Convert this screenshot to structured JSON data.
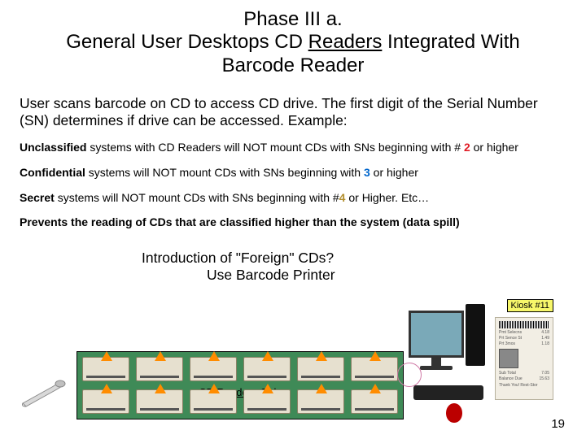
{
  "title": {
    "line1": "Phase III a.",
    "line2_pre": "General User Desktops CD ",
    "line2_under": "Readers",
    "line2_post": " Integrated With",
    "line3": "Barcode Reader"
  },
  "body_intro": "User scans barcode on CD to access CD drive.  The first digit of the Serial Number (SN) determines if drive can be accessed.  Example:",
  "rules": {
    "r1_pre": "Unclassified",
    "r1_mid": " systems with CD Readers will NOT mount CDs with SNs beginning with # ",
    "r1_num": "2",
    "r1_post": " or higher",
    "r2_pre": "Confidential",
    "r2_mid": " systems will NOT mount CDs with SNs beginning with ",
    "r2_num": "3",
    "r2_post": " or higher",
    "r3_pre": "Secret",
    "r3_mid": " systems will NOT mount CDs with SNs beginning with #",
    "r3_num": "4",
    "r3_post": " or Higher. Etc…"
  },
  "prevent": "Prevents the reading of CDs that are classified higher than the system (data spill)",
  "foreign": {
    "line1": "Introduction of \"Foreign\" CDs?",
    "line2": "Use Barcode Printer"
  },
  "rack_label_pre": "CD ",
  "rack_label_under": "Readers",
  "rack_label_post": " Only",
  "kiosk_tag": "Kiosk #11",
  "receipt": {
    "r1a": "Pmt Selecns",
    "r1b": "4.18",
    "r2a": "Prt Sence St",
    "r2b": "1.49",
    "r3a": "Prt 3mos",
    "r3b": "1.18",
    "r4a": "Sub Total",
    "r4b": "7.05",
    "r5a": "Balance Due",
    "r5b": "15.63",
    "r6": "Thank You! Rest-Stor"
  },
  "page_number": "19"
}
